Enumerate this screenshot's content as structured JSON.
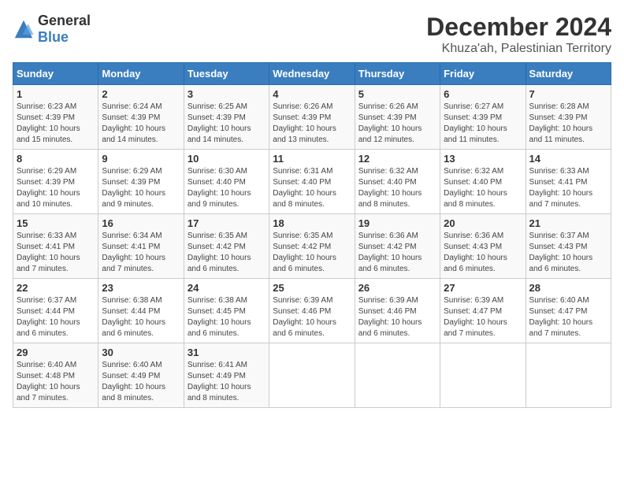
{
  "logo": {
    "general": "General",
    "blue": "Blue"
  },
  "title": "December 2024",
  "subtitle": "Khuza'ah, Palestinian Territory",
  "days_of_week": [
    "Sunday",
    "Monday",
    "Tuesday",
    "Wednesday",
    "Thursday",
    "Friday",
    "Saturday"
  ],
  "weeks": [
    [
      {
        "day": "1",
        "info": "Sunrise: 6:23 AM\nSunset: 4:39 PM\nDaylight: 10 hours\nand 15 minutes."
      },
      {
        "day": "2",
        "info": "Sunrise: 6:24 AM\nSunset: 4:39 PM\nDaylight: 10 hours\nand 14 minutes."
      },
      {
        "day": "3",
        "info": "Sunrise: 6:25 AM\nSunset: 4:39 PM\nDaylight: 10 hours\nand 14 minutes."
      },
      {
        "day": "4",
        "info": "Sunrise: 6:26 AM\nSunset: 4:39 PM\nDaylight: 10 hours\nand 13 minutes."
      },
      {
        "day": "5",
        "info": "Sunrise: 6:26 AM\nSunset: 4:39 PM\nDaylight: 10 hours\nand 12 minutes."
      },
      {
        "day": "6",
        "info": "Sunrise: 6:27 AM\nSunset: 4:39 PM\nDaylight: 10 hours\nand 11 minutes."
      },
      {
        "day": "7",
        "info": "Sunrise: 6:28 AM\nSunset: 4:39 PM\nDaylight: 10 hours\nand 11 minutes."
      }
    ],
    [
      {
        "day": "8",
        "info": "Sunrise: 6:29 AM\nSunset: 4:39 PM\nDaylight: 10 hours\nand 10 minutes."
      },
      {
        "day": "9",
        "info": "Sunrise: 6:29 AM\nSunset: 4:39 PM\nDaylight: 10 hours\nand 9 minutes."
      },
      {
        "day": "10",
        "info": "Sunrise: 6:30 AM\nSunset: 4:40 PM\nDaylight: 10 hours\nand 9 minutes."
      },
      {
        "day": "11",
        "info": "Sunrise: 6:31 AM\nSunset: 4:40 PM\nDaylight: 10 hours\nand 8 minutes."
      },
      {
        "day": "12",
        "info": "Sunrise: 6:32 AM\nSunset: 4:40 PM\nDaylight: 10 hours\nand 8 minutes."
      },
      {
        "day": "13",
        "info": "Sunrise: 6:32 AM\nSunset: 4:40 PM\nDaylight: 10 hours\nand 8 minutes."
      },
      {
        "day": "14",
        "info": "Sunrise: 6:33 AM\nSunset: 4:41 PM\nDaylight: 10 hours\nand 7 minutes."
      }
    ],
    [
      {
        "day": "15",
        "info": "Sunrise: 6:33 AM\nSunset: 4:41 PM\nDaylight: 10 hours\nand 7 minutes."
      },
      {
        "day": "16",
        "info": "Sunrise: 6:34 AM\nSunset: 4:41 PM\nDaylight: 10 hours\nand 7 minutes."
      },
      {
        "day": "17",
        "info": "Sunrise: 6:35 AM\nSunset: 4:42 PM\nDaylight: 10 hours\nand 6 minutes."
      },
      {
        "day": "18",
        "info": "Sunrise: 6:35 AM\nSunset: 4:42 PM\nDaylight: 10 hours\nand 6 minutes."
      },
      {
        "day": "19",
        "info": "Sunrise: 6:36 AM\nSunset: 4:42 PM\nDaylight: 10 hours\nand 6 minutes."
      },
      {
        "day": "20",
        "info": "Sunrise: 6:36 AM\nSunset: 4:43 PM\nDaylight: 10 hours\nand 6 minutes."
      },
      {
        "day": "21",
        "info": "Sunrise: 6:37 AM\nSunset: 4:43 PM\nDaylight: 10 hours\nand 6 minutes."
      }
    ],
    [
      {
        "day": "22",
        "info": "Sunrise: 6:37 AM\nSunset: 4:44 PM\nDaylight: 10 hours\nand 6 minutes."
      },
      {
        "day": "23",
        "info": "Sunrise: 6:38 AM\nSunset: 4:44 PM\nDaylight: 10 hours\nand 6 minutes."
      },
      {
        "day": "24",
        "info": "Sunrise: 6:38 AM\nSunset: 4:45 PM\nDaylight: 10 hours\nand 6 minutes."
      },
      {
        "day": "25",
        "info": "Sunrise: 6:39 AM\nSunset: 4:46 PM\nDaylight: 10 hours\nand 6 minutes."
      },
      {
        "day": "26",
        "info": "Sunrise: 6:39 AM\nSunset: 4:46 PM\nDaylight: 10 hours\nand 6 minutes."
      },
      {
        "day": "27",
        "info": "Sunrise: 6:39 AM\nSunset: 4:47 PM\nDaylight: 10 hours\nand 7 minutes."
      },
      {
        "day": "28",
        "info": "Sunrise: 6:40 AM\nSunset: 4:47 PM\nDaylight: 10 hours\nand 7 minutes."
      }
    ],
    [
      {
        "day": "29",
        "info": "Sunrise: 6:40 AM\nSunset: 4:48 PM\nDaylight: 10 hours\nand 7 minutes."
      },
      {
        "day": "30",
        "info": "Sunrise: 6:40 AM\nSunset: 4:49 PM\nDaylight: 10 hours\nand 8 minutes."
      },
      {
        "day": "31",
        "info": "Sunrise: 6:41 AM\nSunset: 4:49 PM\nDaylight: 10 hours\nand 8 minutes."
      },
      {
        "day": "",
        "info": ""
      },
      {
        "day": "",
        "info": ""
      },
      {
        "day": "",
        "info": ""
      },
      {
        "day": "",
        "info": ""
      }
    ]
  ]
}
